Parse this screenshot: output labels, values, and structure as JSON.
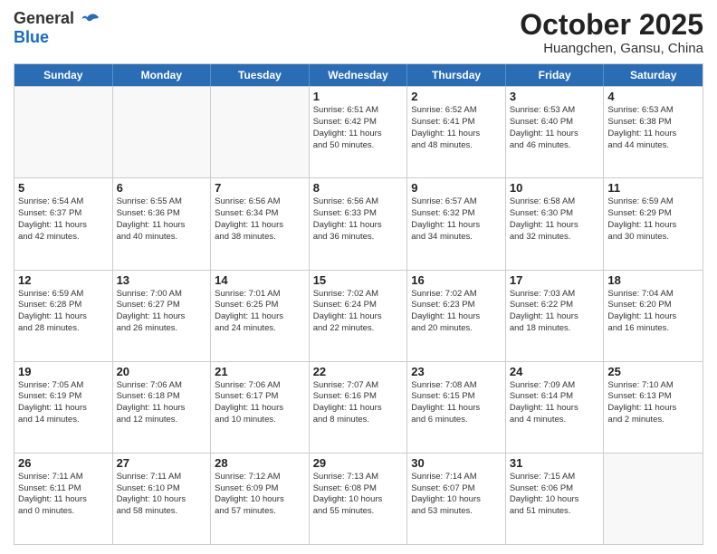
{
  "logo": {
    "line1": "General",
    "line2": "Blue"
  },
  "title": "October 2025",
  "subtitle": "Huangchen, Gansu, China",
  "header_days": [
    "Sunday",
    "Monday",
    "Tuesday",
    "Wednesday",
    "Thursday",
    "Friday",
    "Saturday"
  ],
  "weeks": [
    [
      {
        "day": "",
        "text": ""
      },
      {
        "day": "",
        "text": ""
      },
      {
        "day": "",
        "text": ""
      },
      {
        "day": "1",
        "text": "Sunrise: 6:51 AM\nSunset: 6:42 PM\nDaylight: 11 hours\nand 50 minutes."
      },
      {
        "day": "2",
        "text": "Sunrise: 6:52 AM\nSunset: 6:41 PM\nDaylight: 11 hours\nand 48 minutes."
      },
      {
        "day": "3",
        "text": "Sunrise: 6:53 AM\nSunset: 6:40 PM\nDaylight: 11 hours\nand 46 minutes."
      },
      {
        "day": "4",
        "text": "Sunrise: 6:53 AM\nSunset: 6:38 PM\nDaylight: 11 hours\nand 44 minutes."
      }
    ],
    [
      {
        "day": "5",
        "text": "Sunrise: 6:54 AM\nSunset: 6:37 PM\nDaylight: 11 hours\nand 42 minutes."
      },
      {
        "day": "6",
        "text": "Sunrise: 6:55 AM\nSunset: 6:36 PM\nDaylight: 11 hours\nand 40 minutes."
      },
      {
        "day": "7",
        "text": "Sunrise: 6:56 AM\nSunset: 6:34 PM\nDaylight: 11 hours\nand 38 minutes."
      },
      {
        "day": "8",
        "text": "Sunrise: 6:56 AM\nSunset: 6:33 PM\nDaylight: 11 hours\nand 36 minutes."
      },
      {
        "day": "9",
        "text": "Sunrise: 6:57 AM\nSunset: 6:32 PM\nDaylight: 11 hours\nand 34 minutes."
      },
      {
        "day": "10",
        "text": "Sunrise: 6:58 AM\nSunset: 6:30 PM\nDaylight: 11 hours\nand 32 minutes."
      },
      {
        "day": "11",
        "text": "Sunrise: 6:59 AM\nSunset: 6:29 PM\nDaylight: 11 hours\nand 30 minutes."
      }
    ],
    [
      {
        "day": "12",
        "text": "Sunrise: 6:59 AM\nSunset: 6:28 PM\nDaylight: 11 hours\nand 28 minutes."
      },
      {
        "day": "13",
        "text": "Sunrise: 7:00 AM\nSunset: 6:27 PM\nDaylight: 11 hours\nand 26 minutes."
      },
      {
        "day": "14",
        "text": "Sunrise: 7:01 AM\nSunset: 6:25 PM\nDaylight: 11 hours\nand 24 minutes."
      },
      {
        "day": "15",
        "text": "Sunrise: 7:02 AM\nSunset: 6:24 PM\nDaylight: 11 hours\nand 22 minutes."
      },
      {
        "day": "16",
        "text": "Sunrise: 7:02 AM\nSunset: 6:23 PM\nDaylight: 11 hours\nand 20 minutes."
      },
      {
        "day": "17",
        "text": "Sunrise: 7:03 AM\nSunset: 6:22 PM\nDaylight: 11 hours\nand 18 minutes."
      },
      {
        "day": "18",
        "text": "Sunrise: 7:04 AM\nSunset: 6:20 PM\nDaylight: 11 hours\nand 16 minutes."
      }
    ],
    [
      {
        "day": "19",
        "text": "Sunrise: 7:05 AM\nSunset: 6:19 PM\nDaylight: 11 hours\nand 14 minutes."
      },
      {
        "day": "20",
        "text": "Sunrise: 7:06 AM\nSunset: 6:18 PM\nDaylight: 11 hours\nand 12 minutes."
      },
      {
        "day": "21",
        "text": "Sunrise: 7:06 AM\nSunset: 6:17 PM\nDaylight: 11 hours\nand 10 minutes."
      },
      {
        "day": "22",
        "text": "Sunrise: 7:07 AM\nSunset: 6:16 PM\nDaylight: 11 hours\nand 8 minutes."
      },
      {
        "day": "23",
        "text": "Sunrise: 7:08 AM\nSunset: 6:15 PM\nDaylight: 11 hours\nand 6 minutes."
      },
      {
        "day": "24",
        "text": "Sunrise: 7:09 AM\nSunset: 6:14 PM\nDaylight: 11 hours\nand 4 minutes."
      },
      {
        "day": "25",
        "text": "Sunrise: 7:10 AM\nSunset: 6:13 PM\nDaylight: 11 hours\nand 2 minutes."
      }
    ],
    [
      {
        "day": "26",
        "text": "Sunrise: 7:11 AM\nSunset: 6:11 PM\nDaylight: 11 hours\nand 0 minutes."
      },
      {
        "day": "27",
        "text": "Sunrise: 7:11 AM\nSunset: 6:10 PM\nDaylight: 10 hours\nand 58 minutes."
      },
      {
        "day": "28",
        "text": "Sunrise: 7:12 AM\nSunset: 6:09 PM\nDaylight: 10 hours\nand 57 minutes."
      },
      {
        "day": "29",
        "text": "Sunrise: 7:13 AM\nSunset: 6:08 PM\nDaylight: 10 hours\nand 55 minutes."
      },
      {
        "day": "30",
        "text": "Sunrise: 7:14 AM\nSunset: 6:07 PM\nDaylight: 10 hours\nand 53 minutes."
      },
      {
        "day": "31",
        "text": "Sunrise: 7:15 AM\nSunset: 6:06 PM\nDaylight: 10 hours\nand 51 minutes."
      },
      {
        "day": "",
        "text": ""
      }
    ]
  ]
}
